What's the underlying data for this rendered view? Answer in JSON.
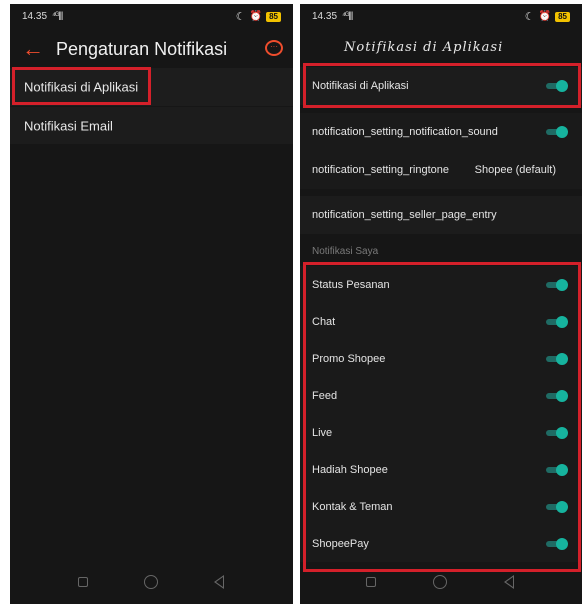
{
  "status": {
    "time": "14.35",
    "signal": "⁴ᴳ|||",
    "battery": "85",
    "moon": "☾",
    "alarm": "⏰"
  },
  "left": {
    "title": "Pengaturan Notifikasi",
    "rows": [
      {
        "label": "Notifikasi di Aplikasi"
      },
      {
        "label": "Notifikasi Email"
      }
    ]
  },
  "right": {
    "title": "Notifikasi di Aplikasi",
    "rows": [
      {
        "label": "Notifikasi di Aplikasi",
        "toggle": true
      },
      {
        "label": "notification_setting_notification_sound",
        "toggle": true
      },
      {
        "label": "notification_setting_ringtone",
        "value": "Shopee (default)"
      },
      {
        "label": "notification_setting_seller_page_entry"
      }
    ],
    "section_title": "Notifikasi Saya",
    "my_notifications": [
      {
        "label": "Status Pesanan",
        "toggle": true
      },
      {
        "label": "Chat",
        "toggle": true
      },
      {
        "label": "Promo Shopee",
        "toggle": true
      },
      {
        "label": "Feed",
        "toggle": true
      },
      {
        "label": "Live",
        "toggle": true
      },
      {
        "label": "Hadiah Shopee",
        "toggle": true
      },
      {
        "label": "Kontak & Teman",
        "toggle": true
      },
      {
        "label": "ShopeePay",
        "toggle": true
      }
    ]
  },
  "colors": {
    "accent": "#ee4d2d",
    "toggle_on": "#16b39e",
    "highlight": "#d4202a",
    "background": "#161616"
  },
  "icons": {
    "back": "arrow-left-icon",
    "chat": "chat-bubble-icon"
  }
}
